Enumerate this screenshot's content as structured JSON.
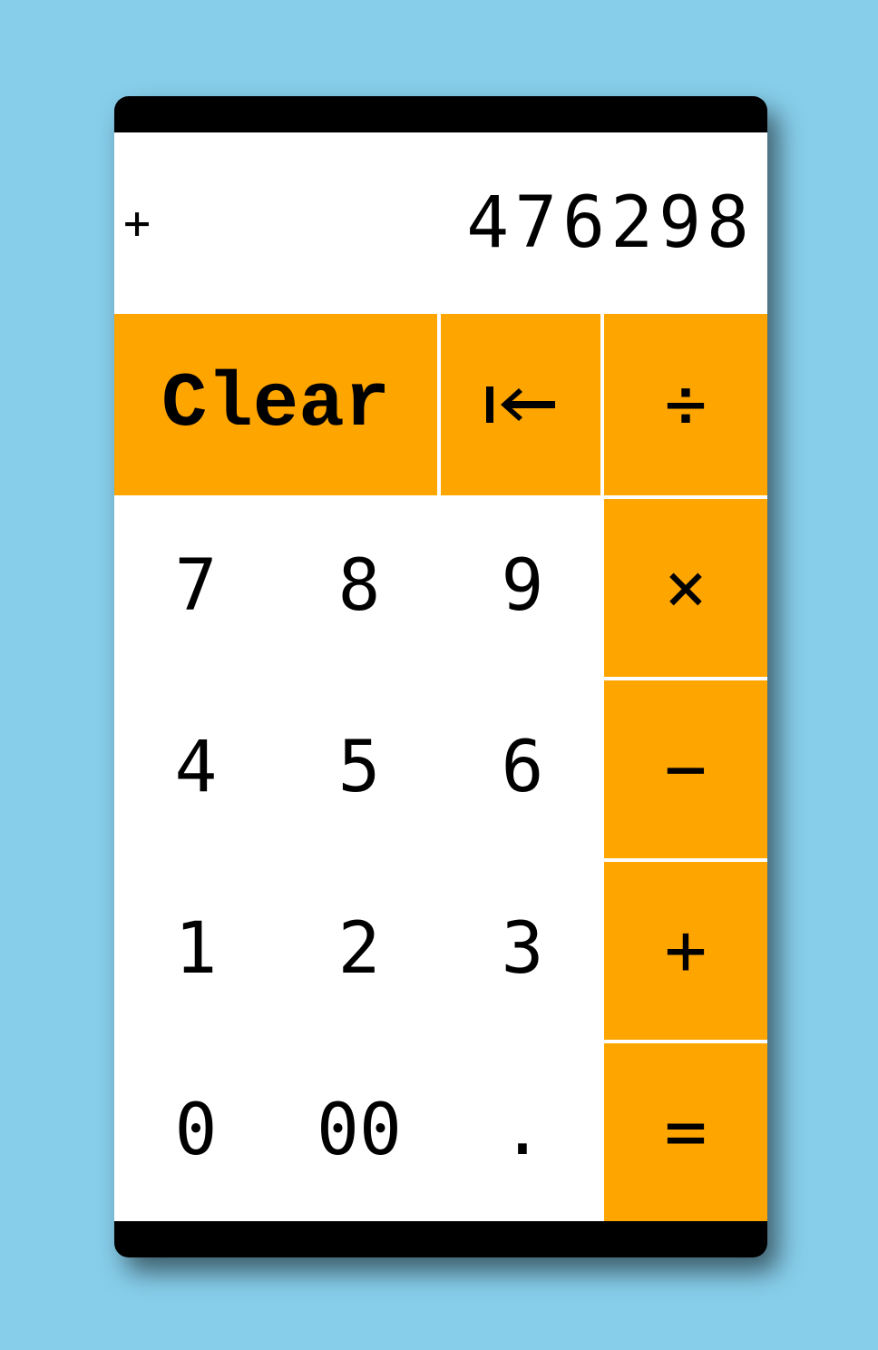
{
  "display": {
    "operator": "+",
    "value": "476298"
  },
  "keys": {
    "clear": "Clear",
    "backspace_icon": "backspace-arrow-icon",
    "divide": "÷",
    "multiply": "×",
    "subtract": "−",
    "add": "+",
    "equals": "=",
    "seven": "7",
    "eight": "8",
    "nine": "9",
    "four": "4",
    "five": "5",
    "six": "6",
    "one": "1",
    "two": "2",
    "three": "3",
    "zero": "0",
    "double_zero": "00",
    "decimal": "."
  },
  "colors": {
    "background": "#87ceeb",
    "accent": "#ffa500",
    "frame": "#000000",
    "display_bg": "#ffffff"
  }
}
